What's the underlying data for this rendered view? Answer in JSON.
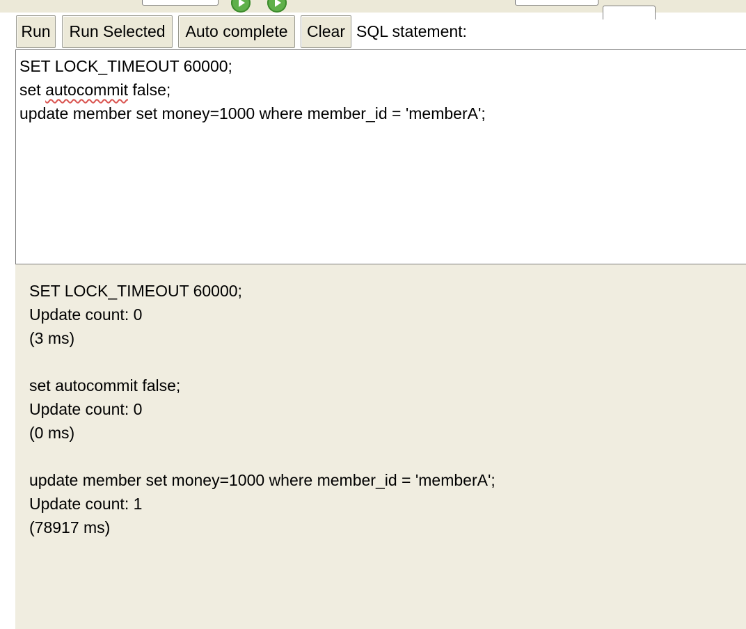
{
  "toolbar": {
    "run_label": "Run",
    "run_selected_label": "Run Selected",
    "auto_complete_label": "Auto complete",
    "clear_label": "Clear",
    "sql_statement_label": "SQL statement:"
  },
  "editor": {
    "lines": [
      "SET LOCK_TIMEOUT 60000;",
      "set ",
      "update member set money=1000 where member_id = 'memberA';"
    ],
    "line2_misspelled": "autocommit",
    "line2_rest": " false;"
  },
  "results": [
    {
      "statement": "SET LOCK_TIMEOUT 60000;",
      "count": "Update count: 0",
      "time": "(3 ms)"
    },
    {
      "statement": "set autocommit false;",
      "count": "Update count: 0",
      "time": "(0 ms)"
    },
    {
      "statement": "update member set money=1000 where member_id = 'memberA';",
      "count": "Update count: 1",
      "time": "(78917 ms)"
    }
  ],
  "icons": {
    "run_icon": "green-play-icon",
    "run_selected_icon": "green-play-icon"
  },
  "colors": {
    "toolbar_bg": "#ece9d8",
    "results_bg": "#f0ede0",
    "spellcheck": "#d9534f"
  }
}
